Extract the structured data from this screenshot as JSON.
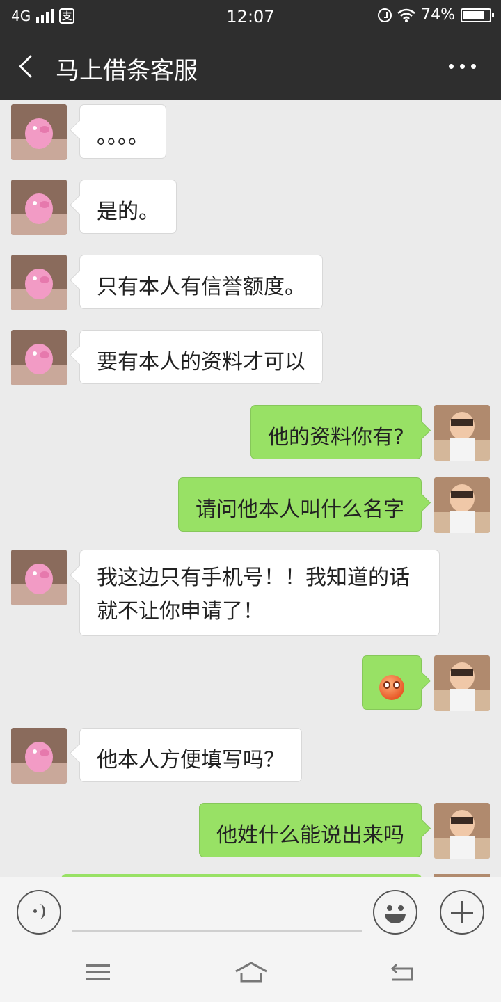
{
  "status_bar": {
    "network": "4G",
    "pay_glyph": "支",
    "time": "12:07",
    "battery": "74%",
    "icons": [
      "signal-icon",
      "alipay-icon",
      "alarm-icon",
      "wifi-icon",
      "battery-icon"
    ]
  },
  "header": {
    "title": "马上借条客服",
    "back_icon": "chevron-left-icon",
    "more_icon": "more-dots-icon"
  },
  "messages": [
    {
      "from": "service",
      "text": "。。。。"
    },
    {
      "from": "service",
      "text": "是的。"
    },
    {
      "from": "service",
      "text": "只有本人有信誉额度。"
    },
    {
      "from": "service",
      "text": "要有本人的资料才可以"
    },
    {
      "from": "me",
      "text": "他的资料你有?"
    },
    {
      "from": "me",
      "text": "请问他本人叫什么名字"
    },
    {
      "from": "service",
      "text": "我这边只有手机号！！我知道的话就不让你申请了！"
    },
    {
      "from": "me",
      "emoji": "flushed-emoji"
    },
    {
      "from": "service",
      "text": "他本人方便填写吗？"
    },
    {
      "from": "me",
      "text": "他姓什么能说出来吗"
    }
  ],
  "input_bar": {
    "voice_icon": "voice-icon",
    "emoji_icon": "smile-icon",
    "plus_icon": "plus-icon",
    "text_value": ""
  },
  "nav_bar": {
    "icons": [
      "menu-icon",
      "home-icon",
      "back-icon"
    ]
  }
}
